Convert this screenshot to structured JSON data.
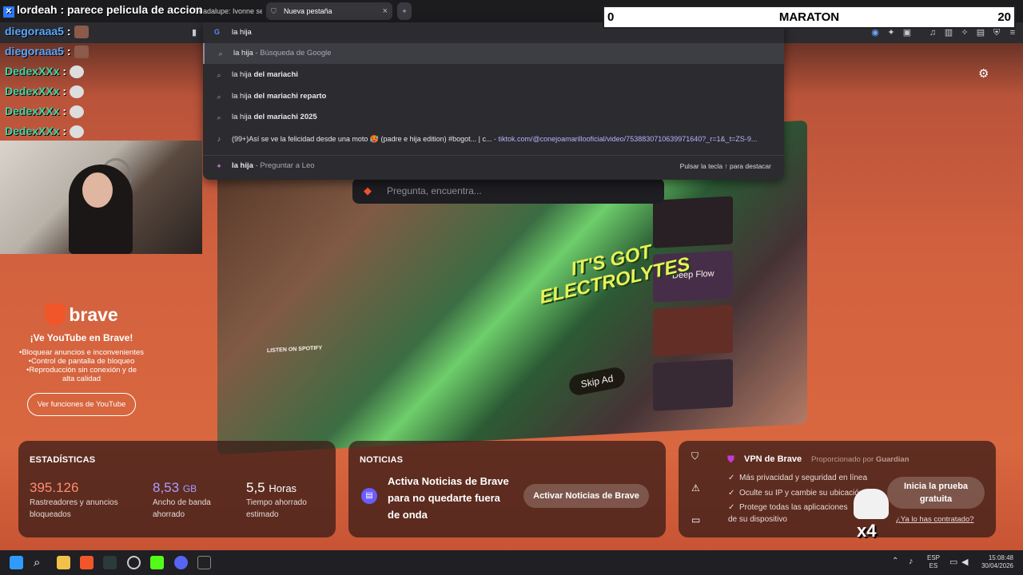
{
  "tabs": [
    {
      "label": "Guadalupe: Ivonne se"
    },
    {
      "label": "Nueva pestaña",
      "close": "×"
    }
  ],
  "new_tab_label": "+",
  "omnibox": {
    "value": "la hija",
    "suggestions": [
      {
        "bold": "la hija",
        "rest": " - Búsqueda de Google"
      },
      {
        "text": "la hija",
        "bold": " del mariachi"
      },
      {
        "text": "la hija",
        "bold": " del mariachi reparto"
      },
      {
        "text": "la hija",
        "bold": " del mariachi 2025"
      },
      {
        "title": "(99+)Así se ve la felicidad desde una moto 🥵 (padre e hija edition) #bogot... | c...",
        "url": " - tiktok.com/@conejoamarillooficial/video/7538830710639971640?_r=1&_t=ZS-9..."
      },
      {
        "bold": "la hija",
        "rest": " - Preguntar a Leo",
        "hint": "Pulsar la tecla ↑ para destacar"
      }
    ]
  },
  "chat": {
    "header": "lordeah : parece pelicula de accion",
    "messages": [
      {
        "user": "diegoraaa5",
        "sep": " :"
      },
      {
        "user": "diegoraaa5",
        "sep": " :"
      },
      {
        "user": "DedexXXx",
        "sep": " :"
      },
      {
        "user": "DedexXXx",
        "sep": " :"
      },
      {
        "user": "DedexXXx",
        "sep": " :"
      },
      {
        "user": "DedexXXx",
        "sep": " :"
      }
    ]
  },
  "marathon": {
    "left": "0",
    "title": "MARATON",
    "right": "20"
  },
  "promo": {
    "brand": "brave",
    "headline": "¡Ve YouTube en Brave!",
    "bullets": [
      "•Bloquear anuncios e inconvenientes",
      "•Control de pantalla de bloqueo",
      "•Reproducción sin conexión y de alta calidad"
    ],
    "button": "Ver funciones de YouTube"
  },
  "hero": {
    "ad_text_1": "IT'S GOT",
    "ad_text_2": "ELECTROLYTES",
    "skip": "Skip Ad",
    "deep_flow": "Deep Flow",
    "spotify": "LISTEN ON SPOTIFY"
  },
  "search": {
    "placeholder": "Pregunta, encuentra..."
  },
  "stats": {
    "title": "ESTADÍSTICAS",
    "trackers": "395.126",
    "trackers_label": "Rastreadores y anuncios bloqueados",
    "bandwidth": "8,53",
    "bandwidth_unit": "GB",
    "bandwidth_label": "Ancho de banda ahorrado",
    "time": "5,5",
    "time_unit": "Horas",
    "time_label": "Tiempo ahorrado estimado"
  },
  "news": {
    "title": "NOTICIAS",
    "text": "Activa Noticias de Brave para no quedarte fuera de onda",
    "button": "Activar Noticias de Brave"
  },
  "vpn": {
    "title": "VPN de Brave",
    "provider": "Proporcionado por",
    "provider_name": "Guardian",
    "features": [
      "Más privacidad y seguridad en línea",
      "Oculte su IP y cambie su ubicación",
      "Protege todas las aplicaciones de su dispositivo"
    ],
    "button": "Inicia la prueba gratuita",
    "link": "¿Ya lo has contratado?"
  },
  "x4": "x4",
  "taskbar": {
    "lang1": "ESP",
    "lang2": "ES",
    "time": "15:08:48",
    "date": "30/04/2026"
  },
  "colors": {
    "accent": "#f1562b",
    "link": "#b8b4ff"
  }
}
